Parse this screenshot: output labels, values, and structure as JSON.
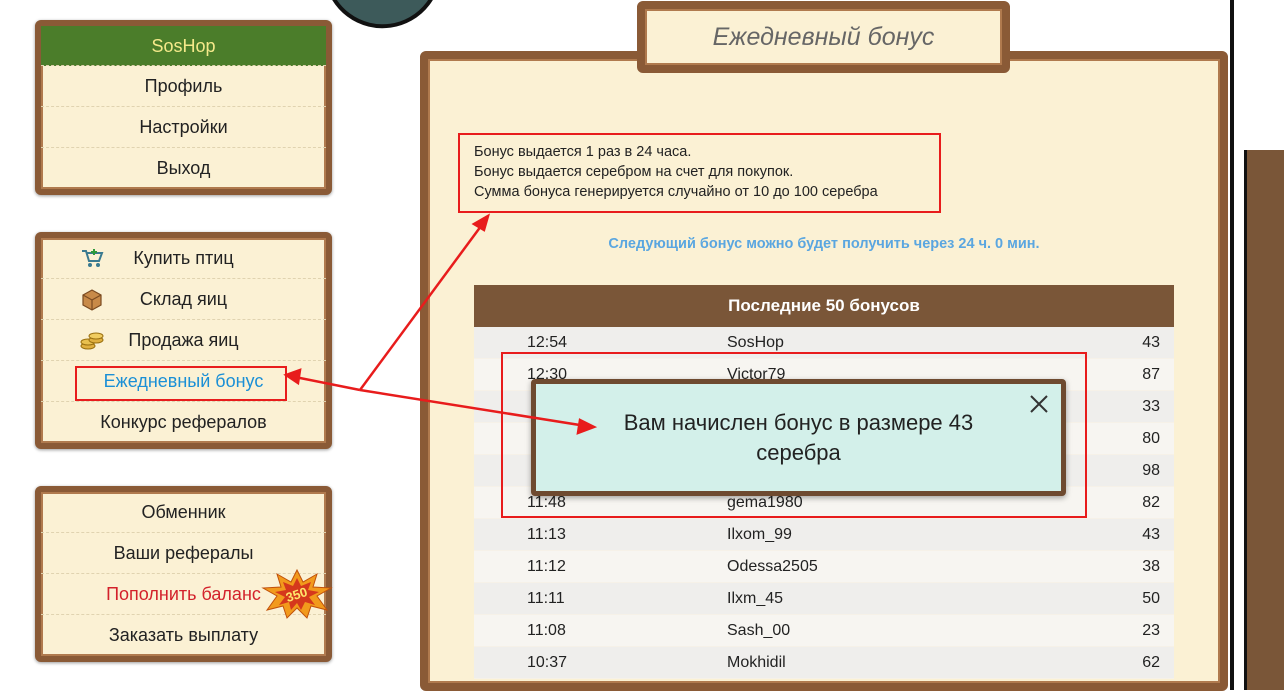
{
  "menu_top": {
    "header": "SosHop",
    "items": [
      "Профиль",
      "Настройки",
      "Выход"
    ]
  },
  "menu_mid": {
    "items": [
      {
        "label": "Купить птиц",
        "icon": "cart-icon"
      },
      {
        "label": "Склад яиц",
        "icon": "box-icon"
      },
      {
        "label": "Продажа яиц",
        "icon": "coins-icon"
      },
      {
        "label": "Ежедневный бонус",
        "icon": ""
      },
      {
        "label": "Конкурс рефералов",
        "icon": ""
      }
    ]
  },
  "menu_bottom": {
    "items": [
      "Обменник",
      "Ваши рефералы",
      "Пополнить баланс",
      "Заказать выплату"
    ],
    "badge": "350"
  },
  "page": {
    "title": "Ежедневный бонус",
    "info_lines": [
      "Бонус выдается 1 раз в 24 часа.",
      "Бонус выдается серебром на счет для покупок.",
      "Сумма бонуса генерируется случайно от 10 до 100 серебра"
    ],
    "next_bonus": "Следующий бонус можно будет получить через 24 ч. 0 мин."
  },
  "table": {
    "title": "Последние 50 бонусов",
    "rows": [
      {
        "time": "12:54",
        "name": "SosHop",
        "amount": "43"
      },
      {
        "time": "12:30",
        "name": "Victor79",
        "amount": "87"
      },
      {
        "time": "",
        "name": "",
        "amount": "33"
      },
      {
        "time": "",
        "name": "",
        "amount": "80"
      },
      {
        "time": "",
        "name": "",
        "amount": "98"
      },
      {
        "time": "11:48",
        "name": "gema1980",
        "amount": "82"
      },
      {
        "time": "11:13",
        "name": "Ilxom_99",
        "amount": "43"
      },
      {
        "time": "11:12",
        "name": "Odessa2505",
        "amount": "38"
      },
      {
        "time": "11:11",
        "name": "Ilxm_45",
        "amount": "50"
      },
      {
        "time": "11:08",
        "name": "Sash_00",
        "amount": "23"
      },
      {
        "time": "10:37",
        "name": "Mokhidil",
        "amount": "62"
      }
    ]
  },
  "modal": {
    "message": "Вам начислен бонус в размере 43 серебра"
  },
  "colors": {
    "frame": "#8a5a36",
    "panel": "#fbf1d4",
    "header_green": "#4b7d2a",
    "table_head": "#7a5638",
    "link_blue": "#1a8fd6",
    "annotation_red": "#e81c1c",
    "modal_bg": "#d3f0ea"
  }
}
